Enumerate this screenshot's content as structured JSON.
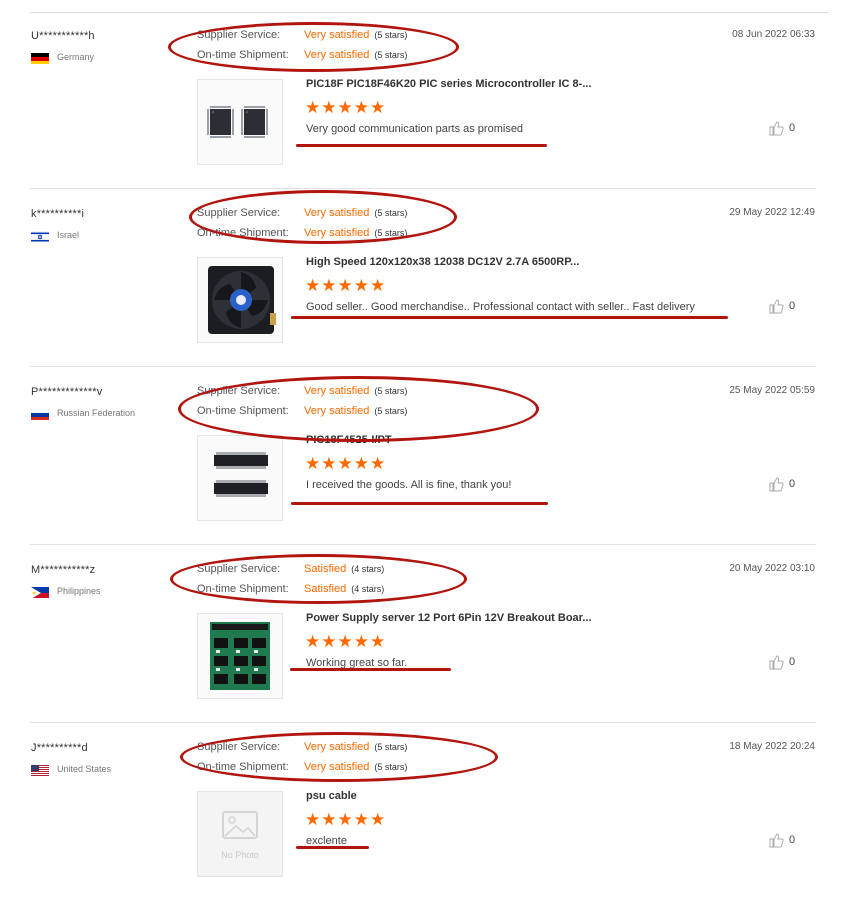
{
  "labels": {
    "supplier_service": "Supplier Service:",
    "ontime_shipment": "On-time Shipment:"
  },
  "colors": {
    "accent": "#ff6a00",
    "annotation": "#b2140e"
  },
  "reviews": [
    {
      "user": "U***********h",
      "country": "Germany",
      "flag": "germany-flag-icon",
      "date": "08 Jun 2022 06:33",
      "supplier_value": "Very satisfied",
      "supplier_stars": "(5 stars)",
      "shipment_value": "Very satisfied",
      "shipment_stars": "(5 stars)",
      "product": "PIC18F PIC18F46K20 PIC series Microcontroller IC 8-...",
      "rating": "★★★★★",
      "rating_value": 5,
      "comment": "Very good communication parts as promised",
      "likes": "0",
      "thumb": "ic-chip-image"
    },
    {
      "user": "k**********i",
      "country": "Israel",
      "flag": "israel-flag-icon",
      "date": "29 May 2022 12:49",
      "supplier_value": "Very satisfied",
      "supplier_stars": "(5 stars)",
      "shipment_value": "Very satisfied",
      "shipment_stars": "(5 stars)",
      "product": "High Speed 120x120x38 12038 DC12V 2.7A 6500RP...",
      "rating": "★★★★★",
      "rating_value": 5,
      "comment": "Good seller.. Good merchandise.. Professional contact with seller.. Fast delivery",
      "likes": "0",
      "thumb": "fan-image"
    },
    {
      "user": "P*************v",
      "country": "Russian Federation",
      "flag": "russia-flag-icon",
      "date": "25 May 2022 05:59",
      "supplier_value": "Very satisfied",
      "supplier_stars": "(5 stars)",
      "shipment_value": "Very satisfied",
      "shipment_stars": "(5 stars)",
      "product": "PIC18F4525-I/PT",
      "rating": "★★★★★",
      "rating_value": 5,
      "comment": "I received the goods. All is fine, thank you!",
      "likes": "0",
      "thumb": "soic-chips-image"
    },
    {
      "user": "M***********z",
      "country": "Philippines",
      "flag": "philippines-flag-icon",
      "date": "20 May 2022 03:10",
      "supplier_value": "Satisfied",
      "supplier_stars": "(4 stars)",
      "shipment_value": "Satisfied",
      "shipment_stars": "(4 stars)",
      "product": "Power Supply server 12 Port 6Pin 12V Breakout Boar...",
      "rating": "★★★★★",
      "rating_value": 5,
      "comment": "Working great so far.",
      "likes": "0",
      "thumb": "breakout-board-image"
    },
    {
      "user": "J**********d",
      "country": "United States",
      "flag": "usa-flag-icon",
      "date": "18 May 2022 20:24",
      "supplier_value": "Very satisfied",
      "supplier_stars": "(5 stars)",
      "shipment_value": "Very satisfied",
      "shipment_stars": "(5 stars)",
      "product": "psu cable",
      "rating": "★★★★★",
      "rating_value": 5,
      "comment": "exclente",
      "likes": "0",
      "thumb": "no-photo-placeholder",
      "no_photo_text": "No Photo"
    }
  ]
}
